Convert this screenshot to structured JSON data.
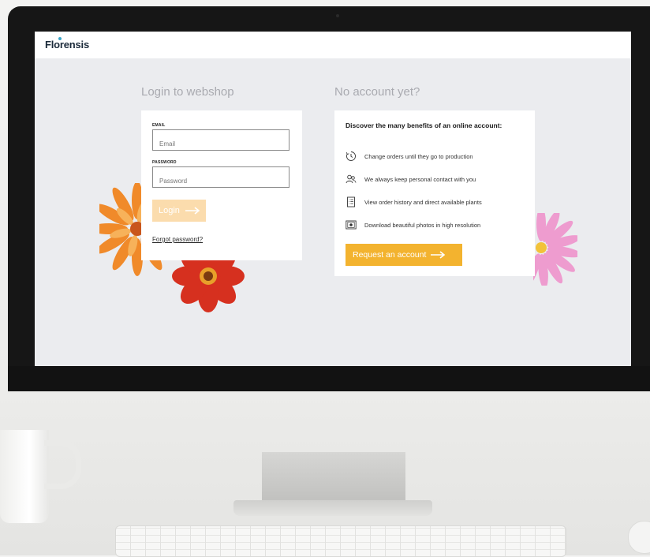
{
  "brand": {
    "logo_text": "Florensis",
    "logo_accent": "#3aa6c9"
  },
  "login": {
    "title": "Login to webshop",
    "email_label": "EMAIL",
    "email_placeholder": "Email",
    "email_value": "",
    "password_label": "PASSWORD",
    "password_placeholder": "Password",
    "password_value": "",
    "login_button_label": "Login",
    "login_button_icon": "arrow-right-icon",
    "forgot_password_label": "Forgot password?"
  },
  "register": {
    "title": "No account yet?",
    "heading": "Discover the many benefits of an online account:",
    "benefits": [
      {
        "icon": "clock-icon",
        "text": "Change orders until they go to production"
      },
      {
        "icon": "users-icon",
        "text": "We always keep personal contact with you"
      },
      {
        "icon": "list-icon",
        "text": "View order history and direct available plants"
      },
      {
        "icon": "photo-icon",
        "text": "Download beautiful photos in high resolution"
      }
    ],
    "request_button_label": "Request an account",
    "request_button_icon": "arrow-right-icon"
  },
  "colors": {
    "accent": "#f3b32f",
    "accent_disabled": "#fbdcad",
    "screen_background": "#ebecef"
  }
}
